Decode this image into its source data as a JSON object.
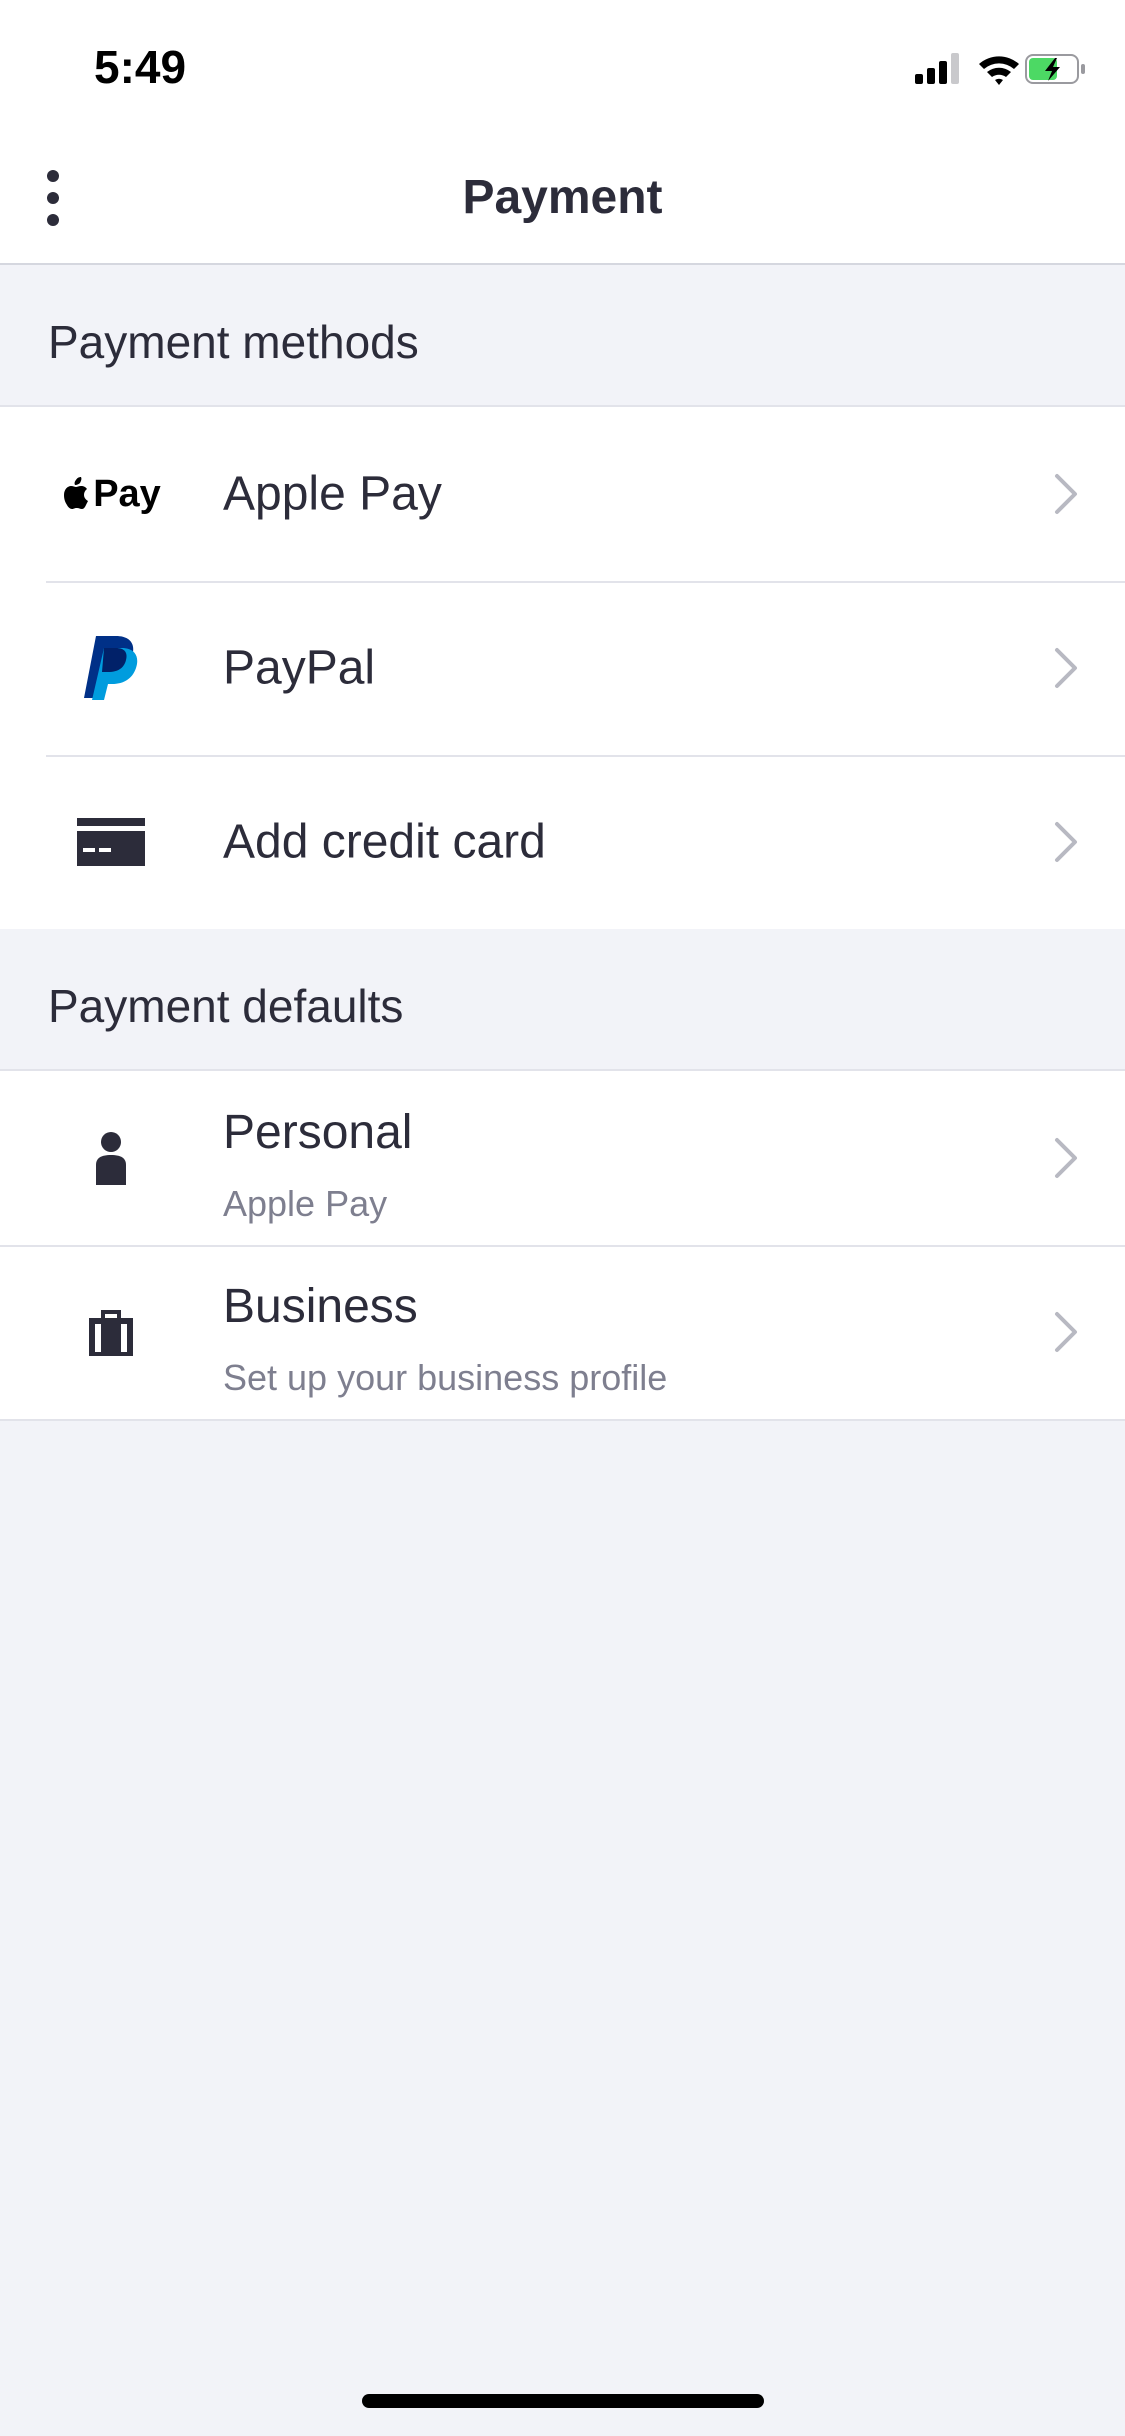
{
  "status_bar": {
    "time": "5:49"
  },
  "header": {
    "title": "Payment"
  },
  "sections": {
    "methods": {
      "title": "Payment methods",
      "items": [
        {
          "label": "Apple Pay",
          "icon": "apple-pay-icon"
        },
        {
          "label": "PayPal",
          "icon": "paypal-icon"
        },
        {
          "label": "Add credit card",
          "icon": "credit-card-icon"
        }
      ]
    },
    "defaults": {
      "title": "Payment defaults",
      "items": [
        {
          "label": "Personal",
          "sublabel": "Apple Pay",
          "icon": "person-icon"
        },
        {
          "label": "Business",
          "sublabel": "Set up your business profile",
          "icon": "briefcase-icon"
        }
      ]
    }
  },
  "icons": {
    "apple_pay_text": "Pay"
  },
  "colors": {
    "background": "#f2f3f8",
    "text": "#2c2c3a",
    "secondary_text": "#7e7f8f",
    "paypal_dark": "#003087",
    "paypal_light": "#009cde",
    "battery_green": "#4cd964"
  }
}
